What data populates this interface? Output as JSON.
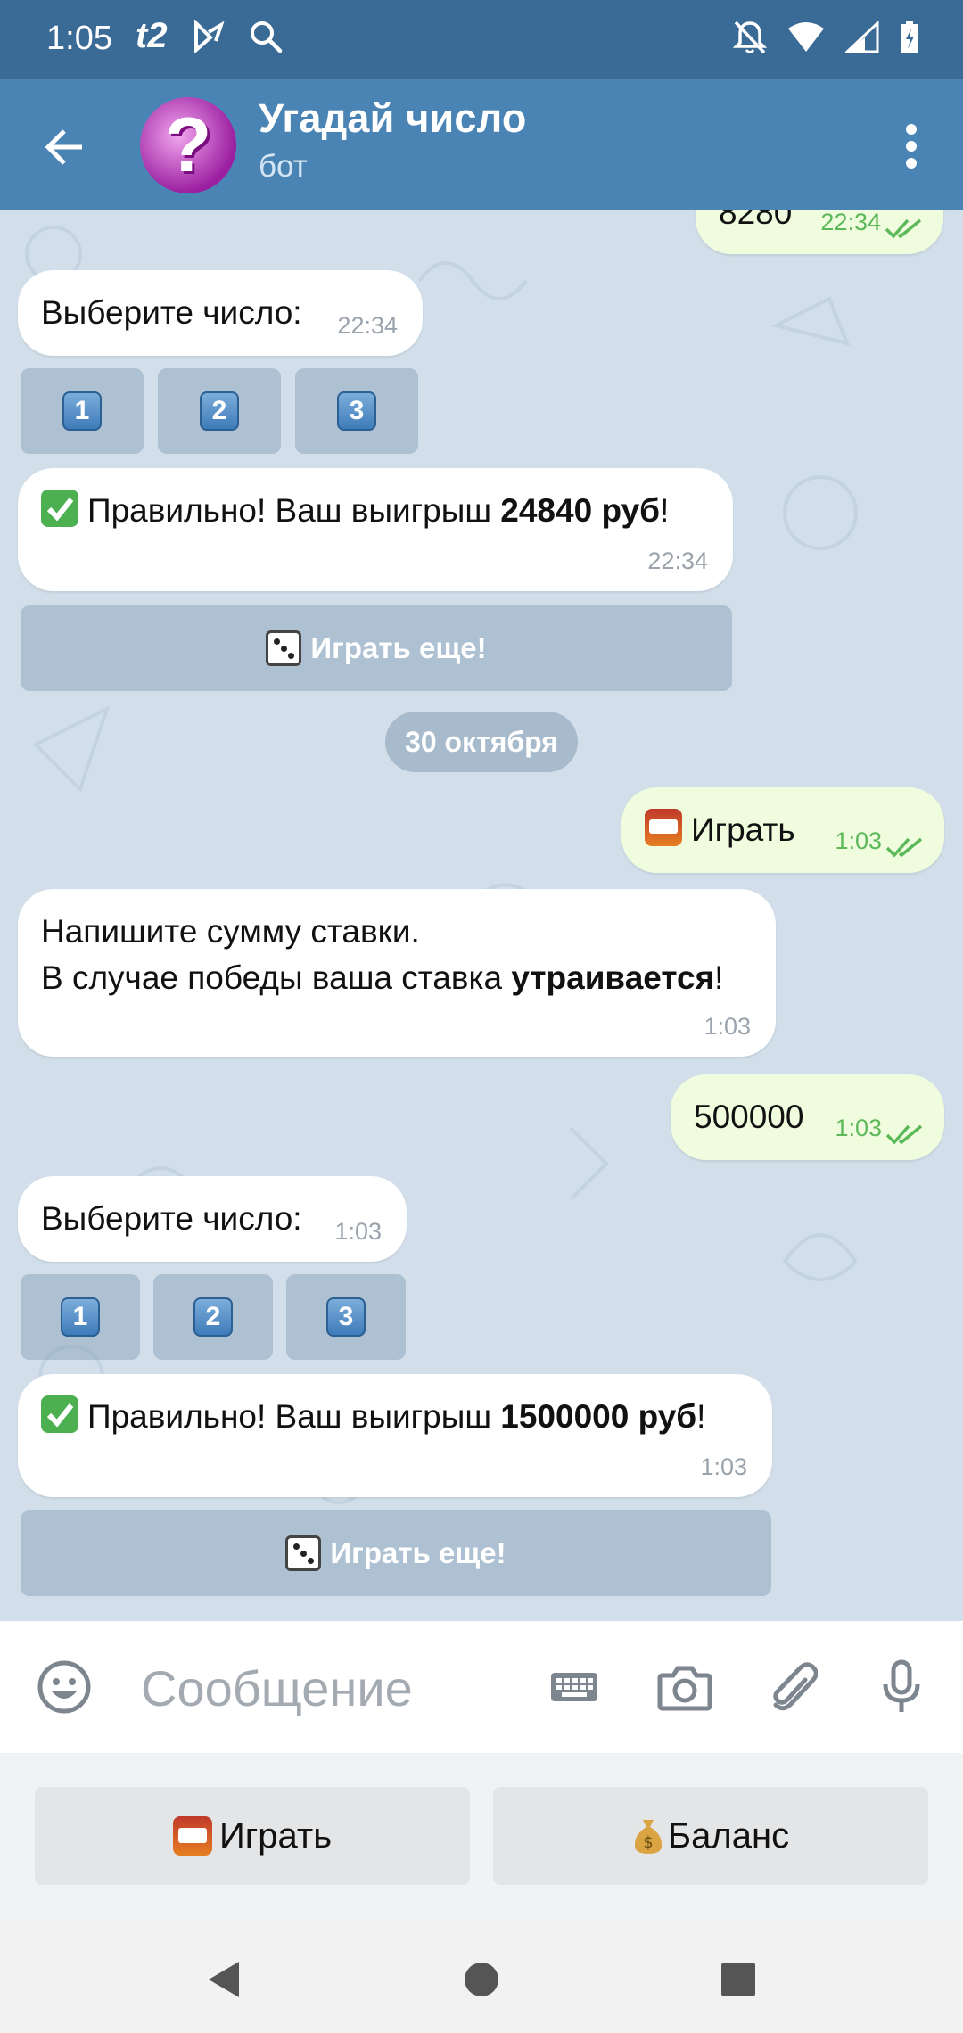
{
  "status": {
    "time": "1:05",
    "carrier": "t2"
  },
  "header": {
    "title": "Угадай число",
    "subtitle": "бот",
    "avatar_glyph": "?"
  },
  "messages": {
    "partial_top": {
      "text": "8280",
      "time": "22:34"
    },
    "choose1": {
      "text": "Выберите число:",
      "time": "22:34"
    },
    "keys1": [
      "1",
      "2",
      "3"
    ],
    "win1": {
      "prefix": "Правильно! Ваш выигрыш ",
      "amount": "24840 руб",
      "suffix": "!",
      "time": "22:34"
    },
    "play_again1": "Играть еще!",
    "date_separator": "30 октября",
    "play_out": {
      "text": "Играть",
      "time": "1:03"
    },
    "bet_prompt": {
      "line1": "Напишите сумму ставки.",
      "line2_prefix": "В случае победы ваша ставка ",
      "line2_bold": "утраивается",
      "line2_suffix": "!",
      "time": "1:03"
    },
    "bet_out": {
      "text": "500000",
      "time": "1:03"
    },
    "choose2": {
      "text": "Выберите число:",
      "time": "1:03"
    },
    "keys2": [
      "1",
      "2",
      "3"
    ],
    "win2": {
      "prefix": "Правильно! Ваш выигрыш ",
      "amount": "1500000 руб",
      "suffix": "!",
      "time": "1:03"
    },
    "play_again2": "Играть еще!"
  },
  "input": {
    "placeholder": "Сообщение"
  },
  "reply_keyboard": {
    "play": "Играть",
    "balance": "Баланс"
  },
  "colors": {
    "status_bar": "#3a6a96",
    "header": "#4a84b5",
    "chat_bg": "#d2dfea",
    "bubble_out": "#effdde",
    "check_green": "#5db85a"
  },
  "icons": {
    "check_emoji": "check-mark-button-icon",
    "dice_emoji": "game-die-icon",
    "slot_emoji": "slot-machine-icon",
    "money_emoji": "money-bag-icon"
  }
}
